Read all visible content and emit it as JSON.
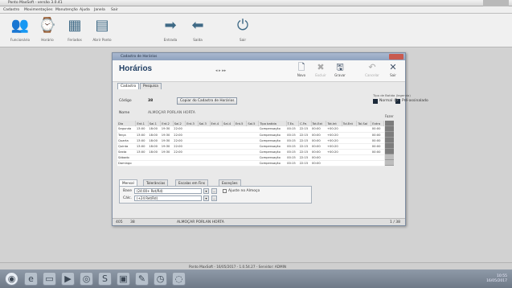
{
  "window": {
    "title": "Ponto MaxSoft - versão 3.0.41"
  },
  "menu": [
    "Cadastro",
    "Movimentações",
    "Manutenção",
    "Ajuda",
    "Janela",
    "Sair"
  ],
  "toolbar": [
    {
      "label": "Funcionário",
      "icon": "people-icon"
    },
    {
      "label": "Horário",
      "icon": "clock-icon"
    },
    {
      "label": "Feriados",
      "icon": "calendar-icon"
    },
    {
      "label": "Abrir Ponto",
      "icon": "document-icon"
    },
    {
      "label": "Entrada",
      "icon": "arrow-right-icon"
    },
    {
      "label": "Saída",
      "icon": "arrow-left-icon"
    },
    {
      "label": "Sair",
      "icon": "power-icon"
    }
  ],
  "dialog": {
    "title": "Cadastro de Horários",
    "heading": "Horários",
    "nav": "◂  ▸  ▸▸",
    "actions": {
      "new": "Novo",
      "delete": "Excluir",
      "save": "Gravar",
      "cancel": "Cancelar",
      "exit": "Sair"
    },
    "tabs": [
      "Cadastro",
      "Pesquisa"
    ],
    "code_label": "Código",
    "code_value": "38",
    "copy_button": "Copiar do Cadastro de Horários",
    "name_label": "Nome",
    "name_value": "ALMOÇAR PORLAN HORTA",
    "legend_caption": "Tipo de Batida (legenda)",
    "legend_normal": "Normal",
    "legend_interval": "Pré-assinalado",
    "fazer_label": "Fazer",
    "grid": {
      "columns": [
        "Dia",
        "Ent.1",
        "Saí.1",
        "Ent.2",
        "Saí.2",
        "Ent.3",
        "Saí.3",
        "Ent.4",
        "Saí.4",
        "Ent.5",
        "Saí.5",
        "Tipo batida",
        "T.Ex.",
        "C.Fe.",
        "Tot.Ext",
        "Tot.Int",
        "Tol.Ent",
        "Tol.Saí",
        "Extra"
      ],
      "rows": [
        [
          "Segunda",
          "13:00",
          "18:00",
          "19:30",
          "22:00",
          "",
          "",
          "",
          "",
          "",
          "",
          "Compensação",
          "00:15",
          "22:15",
          "00:00",
          "+00:20",
          "",
          "",
          "00:00"
        ],
        [
          "Terça",
          "13:00",
          "18:00",
          "19:30",
          "22:00",
          "",
          "",
          "",
          "",
          "",
          "",
          "Compensação",
          "00:15",
          "22:15",
          "00:00",
          "+00:20",
          "",
          "",
          "00:00"
        ],
        [
          "Quarta",
          "13:00",
          "18:00",
          "19:30",
          "22:00",
          "",
          "",
          "",
          "",
          "",
          "",
          "Compensação",
          "00:15",
          "22:15",
          "00:00",
          "+00:20",
          "",
          "",
          "00:00"
        ],
        [
          "Quinta",
          "13:00",
          "18:00",
          "19:30",
          "22:00",
          "",
          "",
          "",
          "",
          "",
          "",
          "Compensação",
          "00:15",
          "22:15",
          "00:00",
          "+00:20",
          "",
          "",
          "00:00"
        ],
        [
          "Sexta",
          "13:00",
          "18:00",
          "19:30",
          "22:00",
          "",
          "",
          "",
          "",
          "",
          "",
          "Compensação",
          "00:15",
          "22:15",
          "00:00",
          "+00:20",
          "",
          "",
          "00:00"
        ],
        [
          "Sábado",
          "",
          "",
          "",
          "",
          "",
          "",
          "",
          "",
          "",
          "",
          "Compensação",
          "00:15",
          "22:15",
          "00:00",
          "",
          "",
          "",
          ""
        ],
        [
          "Domingo",
          "",
          "",
          "",
          "",
          "",
          "",
          "",
          "",
          "",
          "",
          "Compensação",
          "00:15",
          "22:15",
          "00:00",
          "",
          "",
          "",
          ""
        ]
      ]
    },
    "subtabs": [
      "Mensal",
      "Tolerâncias",
      "Escalas em Fins",
      "Exceções"
    ],
    "base_label": "Base",
    "base_value": "(24:00+ Ret/Rd)",
    "calc_label": "Cálc.",
    "calc_value": "(+24 Ret/Rd)",
    "check_label": "Ajuste no Almoço",
    "footer_left": "405",
    "footer_code": "38",
    "footer_name": "ALMOÇAR PORLAN HORTA",
    "footer_right": "1 / 38"
  },
  "status": {
    "text": "Ponto MaxSoft - 16/05/2017 - 1.0.54.27 - Servidor: ADMIN"
  },
  "tray": {
    "time": "10:55",
    "date": "16/05/2017"
  }
}
